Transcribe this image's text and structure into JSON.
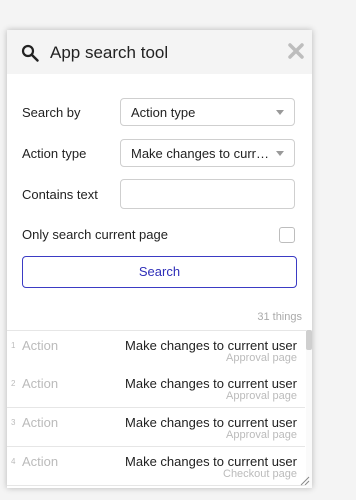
{
  "panel": {
    "title": "App search tool",
    "icons": {
      "search": "search-icon",
      "close": "close-icon",
      "resize": "resize-grip-icon"
    }
  },
  "form": {
    "search_by_label": "Search by",
    "search_by_value": "Action type",
    "action_type_label": "Action type",
    "action_type_value": "Make changes to curre...",
    "contains_text_label": "Contains text",
    "contains_text_value": "",
    "only_current_label": "Only search current page",
    "only_current_checked": false,
    "search_button": "Search"
  },
  "results": {
    "count_text": "31 things",
    "rows": [
      {
        "index": "1",
        "type": "Action",
        "name": "Make changes to current user",
        "page": "Approval page"
      },
      {
        "index": "2",
        "type": "Action",
        "name": "Make changes to current user",
        "page": "Approval page"
      },
      {
        "index": "3",
        "type": "Action",
        "name": "Make changes to current user",
        "page": "Approval page"
      },
      {
        "index": "4",
        "type": "Action",
        "name": "Make changes to current user",
        "page": "Checkout page"
      }
    ]
  },
  "colors": {
    "accent": "#3b3bc4",
    "title_bar_bg": "#f4f4f4",
    "muted_text": "#bbbbbb"
  }
}
